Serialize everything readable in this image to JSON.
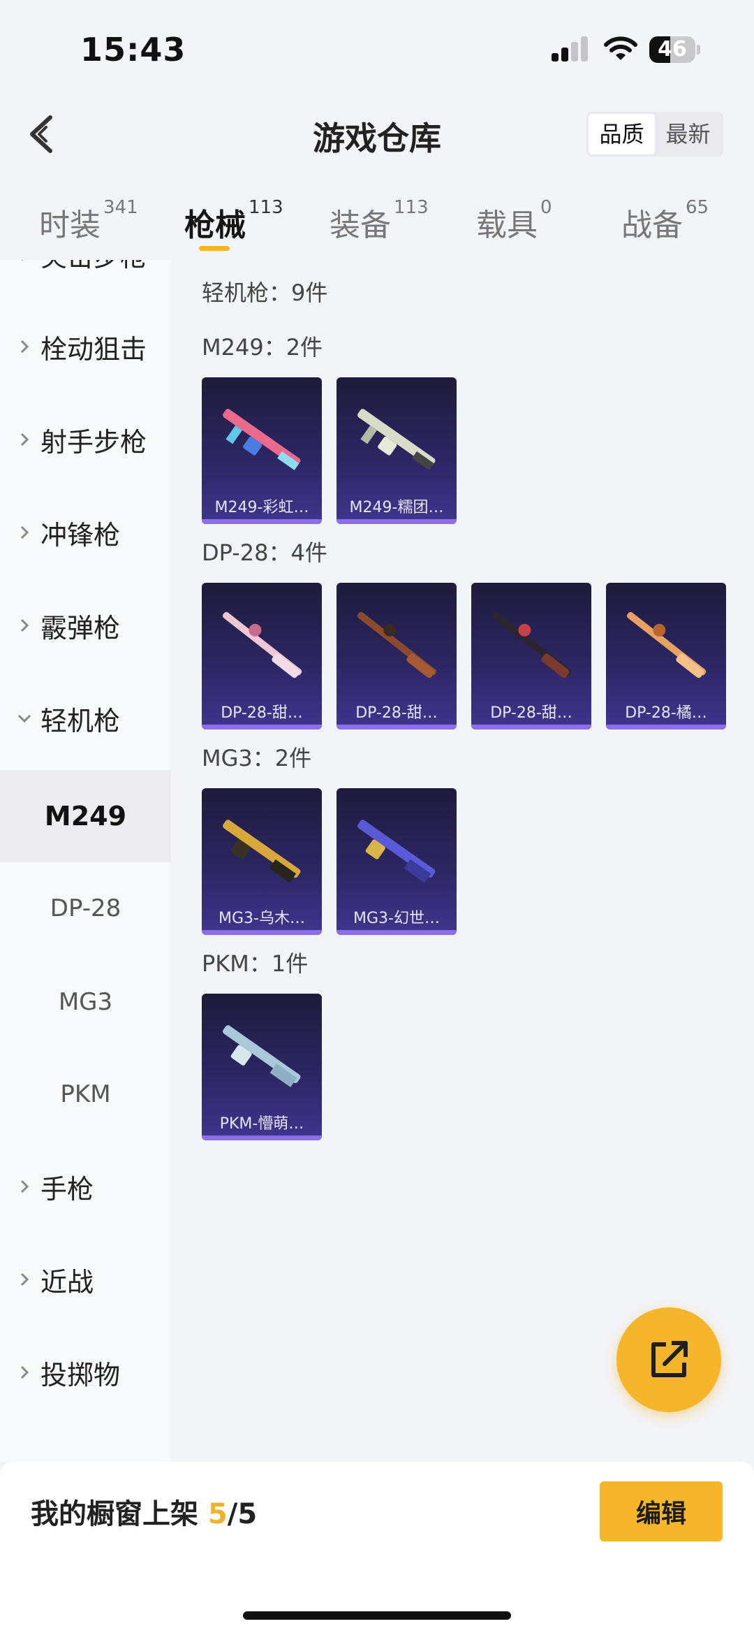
{
  "status_bar": {
    "time": "15:43",
    "battery": "46",
    "battery_level": 0.46
  },
  "header": {
    "title": "游戏仓库",
    "sort_options": [
      "品质",
      "最新"
    ],
    "sort_active": "品质"
  },
  "tabs": [
    {
      "label": "时装",
      "count": "341"
    },
    {
      "label": "枪械",
      "count": "113",
      "active": true
    },
    {
      "label": "装备",
      "count": "113"
    },
    {
      "label": "载具",
      "count": "0"
    },
    {
      "label": "战备",
      "count": "65"
    }
  ],
  "sidebar": {
    "partial_top": "突击步枪",
    "categories": [
      "栓动狙击",
      "射手步枪",
      "冲锋枪",
      "霰弹枪",
      "轻机枪"
    ],
    "subitems": [
      "M249",
      "DP-28",
      "MG3",
      "PKM"
    ],
    "active_sub": "M249",
    "categories_after": [
      "手枪",
      "近战",
      "投掷物"
    ]
  },
  "content": {
    "group_title": "轻机枪：9件",
    "sections": [
      {
        "title": "M249：2件",
        "items": [
          "M249-彩虹…",
          "M249-糯团…"
        ]
      },
      {
        "title": "DP-28：4件",
        "items": [
          "DP-28-甜…",
          "DP-28-甜…",
          "DP-28-甜…",
          "DP-28-橘…"
        ]
      },
      {
        "title": "MG3：2件",
        "items": [
          "MG3-乌木…",
          "MG3-幻世…"
        ]
      },
      {
        "title": "PKM：1件",
        "items": [
          "PKM-懵萌…"
        ]
      }
    ]
  },
  "bottom_bar": {
    "label": "我的橱窗上架",
    "count": "5",
    "total": "/5",
    "edit_label": "编辑"
  },
  "colors": {
    "accent": "#f6b62c",
    "card_bottom": "#8b6fe8"
  },
  "icons": {
    "fab": "external-link-icon",
    "back": "chevron-left-icon"
  }
}
